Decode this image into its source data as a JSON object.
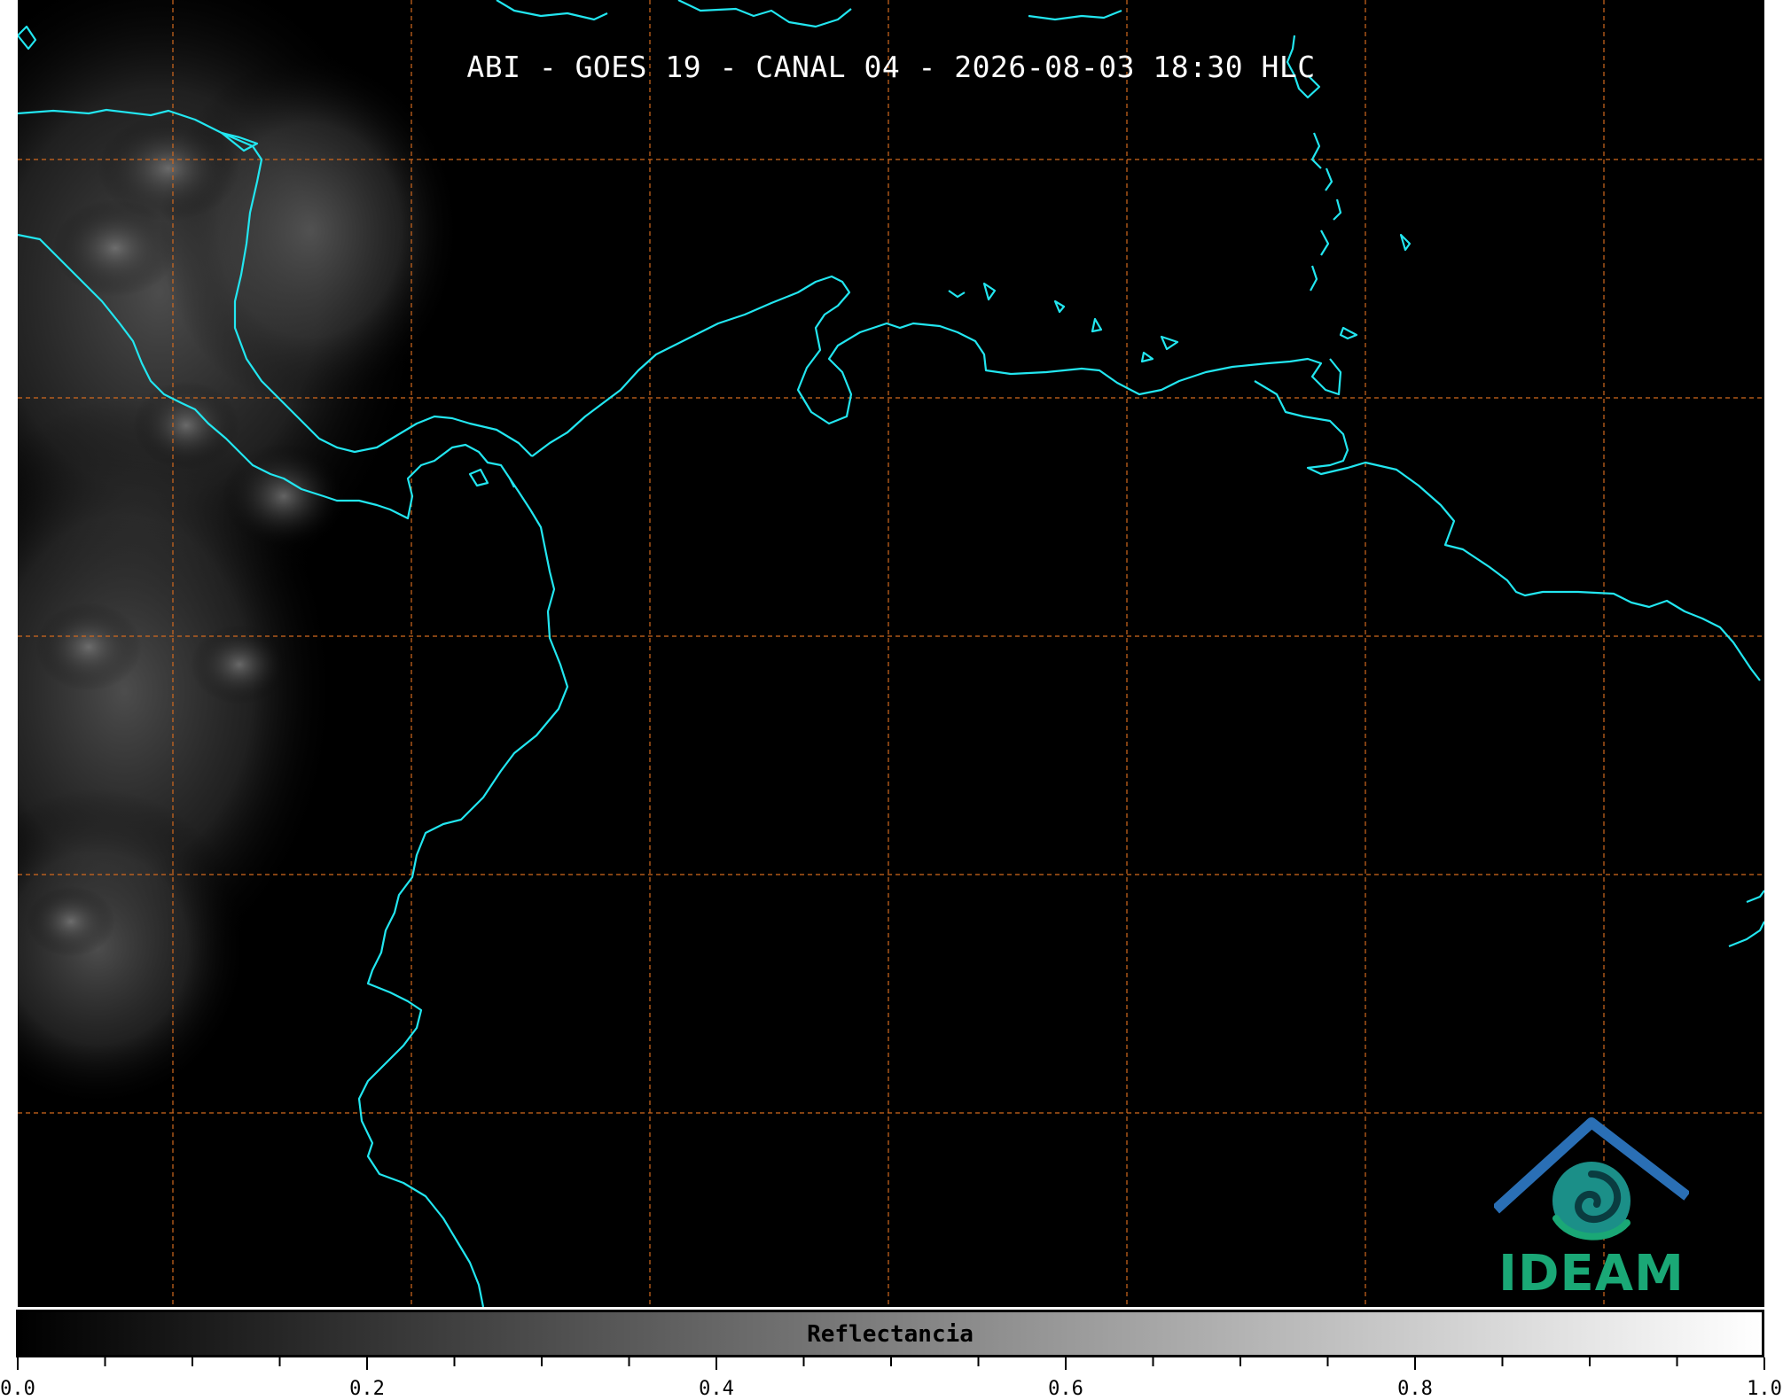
{
  "map": {
    "title": "ABI - GOES 19 - CANAL 04 - 2026-08-03 18:30 HLC",
    "coast_color": "#22e6f0",
    "grid_color": "#d2691e",
    "background": "#000000"
  },
  "logo": {
    "text": "IDEAM",
    "color": "#1aa876",
    "roof_color": "#2a6fb5"
  },
  "colorbar": {
    "label": "Reflectancia",
    "range": [
      0.0,
      1.0
    ],
    "ticks": [
      "0.0",
      "0.2",
      "0.4",
      "0.6",
      "0.8",
      "1.0"
    ]
  }
}
